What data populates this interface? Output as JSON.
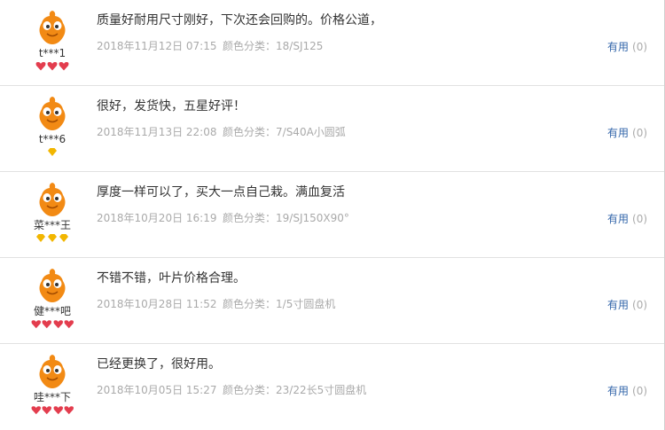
{
  "reviews": [
    {
      "nick": "t***1",
      "content": "质量好耐用尺寸刚好，下次还会回购的。价格公道，",
      "date": "2018年11月12日 07:15",
      "spec_label": "颜色分类：",
      "spec_value": "18/SJ125",
      "useful_label": "有用",
      "useful_count": "(0)",
      "badge": "red-heart",
      "badge_count": 3
    },
    {
      "nick": "t***6",
      "content": "很好，发货快，五星好评！",
      "date": "2018年11月13日 22:08",
      "spec_label": "颜色分类：",
      "spec_value": "7/S40A小圆弧",
      "useful_label": "有用",
      "useful_count": "(0)",
      "badge": "yellow-diamond",
      "badge_count": 1
    },
    {
      "nick": "菜***王",
      "content": "厚度一样可以了，买大一点自己栽。满血复活",
      "date": "2018年10月20日 16:19",
      "spec_label": "颜色分类：",
      "spec_value": "19/SJ150X90°",
      "useful_label": "有用",
      "useful_count": "(0)",
      "badge": "yellow-diamond",
      "badge_count": 3
    },
    {
      "nick": "健***吧",
      "content": "不错不错，叶片价格合理。",
      "date": "2018年10月28日 11:52",
      "spec_label": "颜色分类：",
      "spec_value": "1/5寸圆盘机",
      "useful_label": "有用",
      "useful_count": "(0)",
      "badge": "red-heart",
      "badge_count": 4
    },
    {
      "nick": "哇***下",
      "content": "已经更换了，很好用。",
      "date": "2018年10月05日 15:27",
      "spec_label": "颜色分类：",
      "spec_value": "23/22长5寸圆盘机",
      "useful_label": "有用",
      "useful_count": "(0)",
      "badge": "red-heart",
      "badge_count": 4
    }
  ],
  "colors": {
    "avatar": "#f28a14",
    "link": "#3366aa",
    "muted": "#aaaaaa",
    "heart": "#e33d4e",
    "diamond": "#f2b600"
  }
}
